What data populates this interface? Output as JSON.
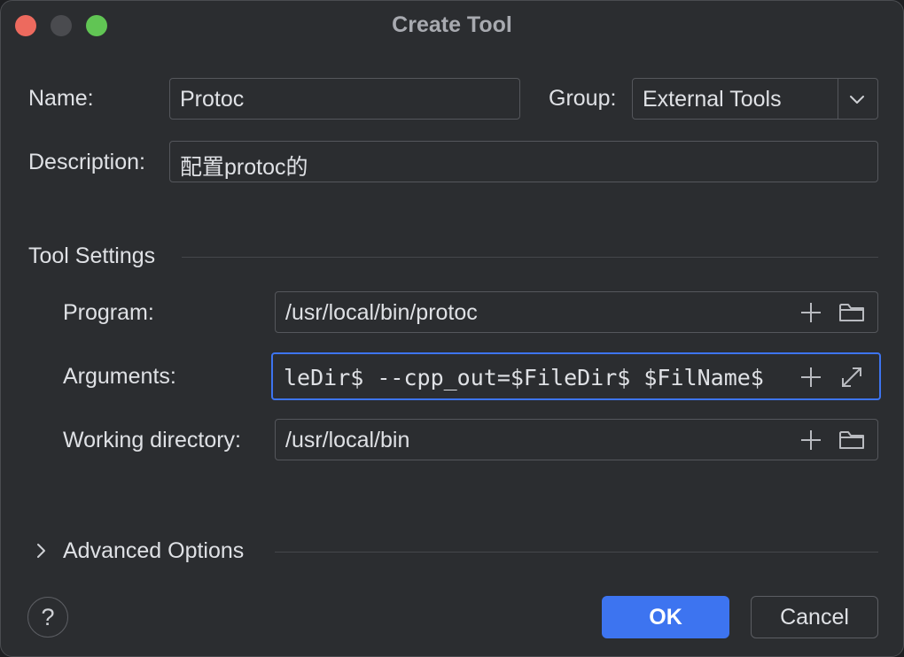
{
  "window": {
    "title": "Create Tool"
  },
  "form": {
    "name_label": "Name:",
    "name_value": "Protoc",
    "group_label": "Group:",
    "group_value": "External Tools",
    "description_label": "Description:",
    "description_value": "配置protoc的"
  },
  "tool_settings": {
    "section_title": "Tool Settings",
    "program_label": "Program:",
    "program_value": "/usr/local/bin/protoc",
    "arguments_label": "Arguments:",
    "arguments_value": "leDir$ --cpp_out=$FileDir$ $FilName$",
    "working_dir_label": "Working directory:",
    "working_dir_value": "/usr/local/bin"
  },
  "advanced": {
    "label": "Advanced Options",
    "expanded": false
  },
  "footer": {
    "help_label": "?",
    "ok_label": "OK",
    "cancel_label": "Cancel"
  },
  "colors": {
    "accent": "#3d74f0",
    "close": "#ed6a5e",
    "maximize": "#61c554"
  },
  "icons": [
    "plus-icon",
    "folder-icon",
    "expand-icon",
    "chevron-down-icon",
    "chevron-right-icon"
  ]
}
